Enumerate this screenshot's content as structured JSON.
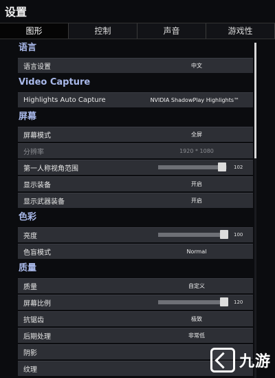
{
  "title": "设置",
  "tabs": [
    {
      "label": "图形",
      "active": true
    },
    {
      "label": "控制",
      "active": false
    },
    {
      "label": "声音",
      "active": false
    },
    {
      "label": "游戏性",
      "active": false
    }
  ],
  "sections": {
    "language": {
      "title": "语言",
      "rows": [
        {
          "label": "语言设置",
          "value": "中文"
        }
      ]
    },
    "video_capture": {
      "title": "Video Capture",
      "rows": [
        {
          "label": "Highlights Auto Capture",
          "value": "NVIDIA ShadowPlay Highlights™"
        }
      ]
    },
    "screen": {
      "title": "屏幕",
      "rows": [
        {
          "label": "屏幕模式",
          "value": "全屏"
        },
        {
          "label": "分辨率",
          "value": "1920 * 1080"
        },
        {
          "label": "第一人称视角范围",
          "slider_value": "102",
          "slider_fraction": 0.93
        },
        {
          "label": "显示装备",
          "value": "开启"
        },
        {
          "label": "显示武器装备",
          "value": "开启"
        }
      ]
    },
    "color": {
      "title": "色彩",
      "rows": [
        {
          "label": "亮度",
          "slider_value": "100",
          "slider_fraction": 0.96
        },
        {
          "label": "色盲模式",
          "value": "Normal"
        }
      ]
    },
    "quality": {
      "title": "质量",
      "rows": [
        {
          "label": "质量",
          "value": "自定义"
        },
        {
          "label": "屏幕比例",
          "slider_value": "120",
          "slider_fraction": 0.96
        },
        {
          "label": "抗锯齿",
          "value": "极致"
        },
        {
          "label": "后期处理",
          "value": "非常低"
        },
        {
          "label": "阴影",
          "value": ""
        },
        {
          "label": "纹理",
          "value": ""
        }
      ]
    }
  },
  "watermark": {
    "text": "九游"
  }
}
